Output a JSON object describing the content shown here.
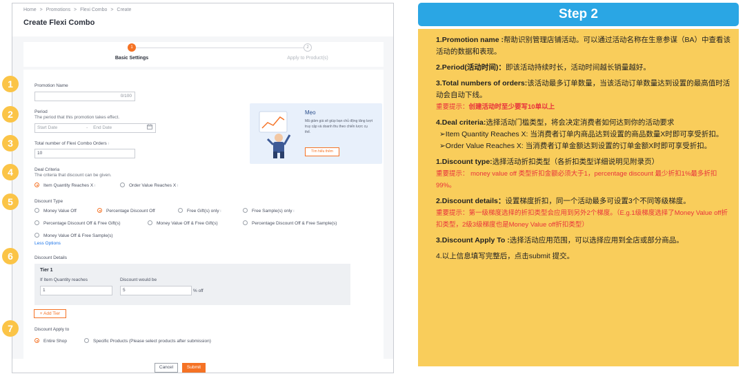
{
  "left": {
    "breadcrumb": [
      "Home",
      ">",
      "Promotions",
      ">",
      "Flexi Combo",
      ">",
      "Create"
    ],
    "page_title": "Create Flexi Combo",
    "steps": [
      {
        "num": "1",
        "label": "Basic Settings"
      },
      {
        "num": "2",
        "label": "Apply to Product(s)"
      }
    ],
    "badges": [
      "1",
      "2",
      "3",
      "4",
      "5",
      "6",
      "7"
    ],
    "promotion_name": {
      "label": "Promotion Name",
      "counter": "0/100",
      "value": ""
    },
    "period": {
      "label": "Period",
      "sub": "The period that this promotion takes effect.",
      "start_placeholder": "Start Date",
      "separator": "-",
      "end_placeholder": "End Date"
    },
    "total_orders": {
      "label": "Total number of Flexi Combo Orders",
      "value": "10"
    },
    "deal_criteria": {
      "label": "Deal Criteria",
      "sub": "The criteria that discount can be given.",
      "options": [
        "Item Quantity Reaches X",
        "Order Value Reaches X"
      ],
      "selected": 0
    },
    "discount_type": {
      "label": "Discount Type",
      "options": [
        "Money Value Off",
        "Percentage Discount Off",
        "Free Gift(s) only",
        "Free Sample(s) only",
        "Percentage Discount Off & Free Gift(s)",
        "Money Value Off & Free Gift(s)",
        "Percentage Discount Off & Free Sample(s)",
        "Money Value Off & Free Sample(s)"
      ],
      "selected": 1,
      "less_options": "Less Options"
    },
    "discount_details": {
      "label": "Discount Details",
      "tier_title": "Tier 1",
      "col1_label": "If Item Quantity reaches",
      "col1_value": "1",
      "col2_label": "Discount would be",
      "col2_value": "5",
      "col2_suffix": "% off",
      "add_tier": "+ Add Tier"
    },
    "apply_to": {
      "label": "Discount Apply to",
      "options": [
        "Entire Shop",
        "Specific Products (Please select products after submission)"
      ],
      "selected": 0
    },
    "tip": {
      "title": "Mẹo",
      "text": "Mã giảm giá sẽ giúp bạn chủ động tăng lượt truy cập và doanh thu theo chiến lược cụ thể.",
      "button": "Tìm hiểu thêm"
    },
    "buttons": {
      "cancel": "Cancel",
      "submit": "Submit"
    },
    "info_icon": "i"
  },
  "right": {
    "step_title": "Step 2",
    "p1_b": "1.Promotion name :",
    "p1_t": "帮助识别管理店铺活动。可以通过活动名称在生意参谋（BA）中查看该活动的数据和表现。",
    "p2_b": "2.Period(活动时间)：",
    "p2_t": "即该活动持续时长，活动时间越长销量越好。",
    "p3_b": "3.Total numbers of orders:",
    "p3_t": "该活动最多订单数量，当该活动订单数量达到设置的最高值时活动会自动下线。",
    "p3_red_a": "重要提示：",
    "p3_red_b": "创建活动时至少要写10单以上",
    "p4_b": "4.Deal criteria:",
    "p4_t": "选择活动门槛类型，将会决定消费者如何达到你的活动要求",
    "p4_l1": "➢Item Quantity Reaches X: 当消费者订单内商品达到设置的商品数量X时即可享受折扣。",
    "p4_l2": "➢Order Value Reaches X: 当消费者订单金额达到设置的订单金额X时即可享受折扣。",
    "p5_b": "1.Discount type:",
    "p5_t": "选择活动折扣类型（各折扣类型详细说明见附录页）",
    "p5_red": "重要提示： money value off 类型折扣金额必须大于1，percentage discount 最少折扣1%最多折扣99%。",
    "p6_b": "2.Discount details：",
    "p6_t": "设置梯度折扣，同一个活动最多可设置3个不同等级梯度。",
    "p6_red": "重要提示：第一级梯度选择的折扣类型会应用到另外2个梯度。（E.g.1级梯度选择了Money Value off折扣类型，2级3级梯度也是Money Value off折扣类型）",
    "p7_b": "3.Discount Apply To :",
    "p7_t": "选择活动应用范围，可以选择应用到全店或部分商品。",
    "p8": "4.以上信息填写完整后，点击submit 提交。"
  },
  "colors": {
    "accent": "#f57224",
    "badge": "#fbc447",
    "header": "#2aa6e4",
    "notes_bg": "#f9cd5b",
    "warning": "#e8323c"
  }
}
